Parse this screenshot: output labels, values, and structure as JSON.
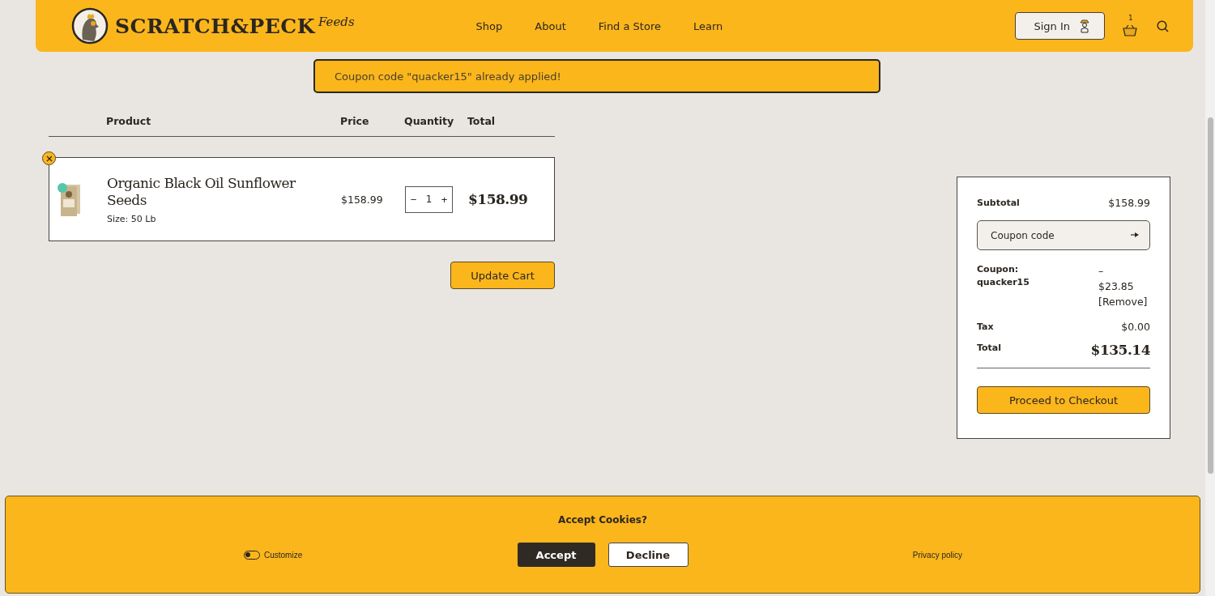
{
  "header": {
    "logo": {
      "wordmark": "SCRATCH&PECK",
      "script": "Feeds"
    },
    "nav": [
      {
        "label": "Shop"
      },
      {
        "label": "About"
      },
      {
        "label": "Find a Store"
      },
      {
        "label": "Learn"
      }
    ],
    "sign_in": "Sign In",
    "cart_count": "1"
  },
  "notice": "Coupon code \"quacker15\" already applied!",
  "cart": {
    "columns": [
      "Product",
      "Price",
      "Quantity",
      "Total"
    ],
    "items": [
      {
        "name": "Organic Black Oil Sunflower Seeds",
        "size": "Size: 50 Lb",
        "price": "$158.99",
        "quantity": "1",
        "total": "$158.99",
        "minus": "−",
        "plus": "+"
      }
    ],
    "update_button": "Update Cart"
  },
  "summary": {
    "subtotal_label": "Subtotal",
    "subtotal": "$158.99",
    "coupon_placeholder": "Coupon code",
    "coupon_label": "Coupon: quacker15",
    "coupon_dash": "–",
    "coupon_amount": "$23.85",
    "remove": "[Remove]",
    "tax_label": "Tax",
    "tax": "$0.00",
    "total_label": "Total",
    "total": "$135.14",
    "checkout": "Proceed to Checkout"
  },
  "cookie_banner": {
    "title": "Accept Cookies?",
    "customize": "Customize",
    "customize_on": false,
    "accept": "Accept",
    "decline": "Decline",
    "privacy": "Privacy policy"
  }
}
